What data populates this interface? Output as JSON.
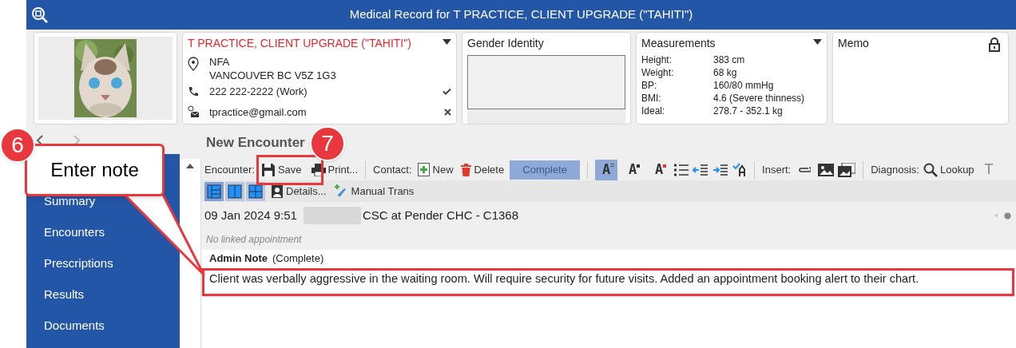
{
  "window": {
    "title": "Medical Record for T PRACTICE, CLIENT UPGRADE (\"TAHITI\")"
  },
  "client": {
    "name": "T PRACTICE, CLIENT UPGRADE (\"TAHITI\")",
    "address_lines": [
      "NFA",
      "VANCOUVER BC V5Z 1G3"
    ],
    "phone": "222 222-2222 (Work)",
    "phone_verified": true,
    "email": "tpractice@gmail.com",
    "email_verified": false
  },
  "gender_identity": {
    "title": "Gender Identity"
  },
  "measurements": {
    "title": "Measurements",
    "rows": [
      {
        "label": "Height:",
        "value": "383 cm"
      },
      {
        "label": "Weight:",
        "value": "68 kg"
      },
      {
        "label": "BP:",
        "value": "160/80 mmHg"
      },
      {
        "label": "BMI:",
        "value": "4.6 (Severe thinness)"
      },
      {
        "label": "Ideal:",
        "value": "278.7 - 352.1 kg"
      }
    ]
  },
  "memo": {
    "title": "Memo",
    "locked": true
  },
  "page_title": "New Encounter",
  "sidebar": {
    "items": [
      "Summary",
      "Encounters",
      "Prescriptions",
      "Results",
      "Documents"
    ]
  },
  "toolbar": {
    "encounter_label": "Encounter:",
    "save": "Save",
    "print": "Print...",
    "contact_label": "Contact:",
    "new": "New",
    "delete": "Delete",
    "complete": {
      "label": "Complete",
      "disabled": true
    },
    "format_buttons": [
      {
        "glyph": "A",
        "selected": true
      },
      {
        "glyph": "A",
        "selected": false
      },
      {
        "glyph": "A",
        "selected": false
      }
    ],
    "insert_label": "Insert:",
    "diagnosis_label": "Diagnosis:",
    "lookup": "Lookup",
    "cut_glyph": "T",
    "layout_buttons": [
      {
        "selected": true
      },
      {
        "selected": false
      },
      {
        "selected": false
      }
    ],
    "details": "Details...",
    "manual_trans": "Manual Trans"
  },
  "encounter": {
    "date": "09 Jan 2024 9:51",
    "location": "CSC at Pender CHC - C1368",
    "appointment": "No linked appointment",
    "note_type": "Admin Note",
    "note_status": "(Complete)",
    "note_text": "Client was verbally aggressive in the waiting room. Will require security for future visits. Added an appointment booking alert to their chart."
  },
  "callouts": [
    {
      "number": "6",
      "text": "Enter note"
    },
    {
      "number": "7"
    }
  ]
}
